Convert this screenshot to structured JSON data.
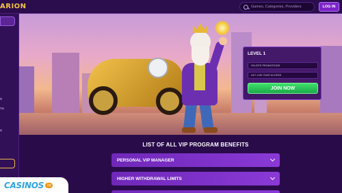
{
  "header": {
    "logo_text": "ARION",
    "search_placeholder": "Games, Categories, Providers",
    "login_label": "LOG IN"
  },
  "sidebar": {
    "items": [
      "S",
      "TS",
      "S"
    ]
  },
  "level_card": {
    "title": "LEVEL 1",
    "perks": [
      "ON-SITE PROMOTIONS",
      "24/7 LIVE CHAT ACCESS"
    ],
    "join_label": "JOIN NOW"
  },
  "benefits": {
    "title": "LIST OF ALL VIP PROGRAM BENEFITS",
    "items": [
      "PERSONAL VIP MANAGER",
      "HIGHER WITHDRAWAL LIMITS"
    ]
  },
  "watermark": {
    "text": "CASINOS",
    "badge": "ca"
  },
  "colors": {
    "brand_purple": "#6f28b8",
    "join_green": "#2fc25a",
    "gold": "#f5c542"
  }
}
